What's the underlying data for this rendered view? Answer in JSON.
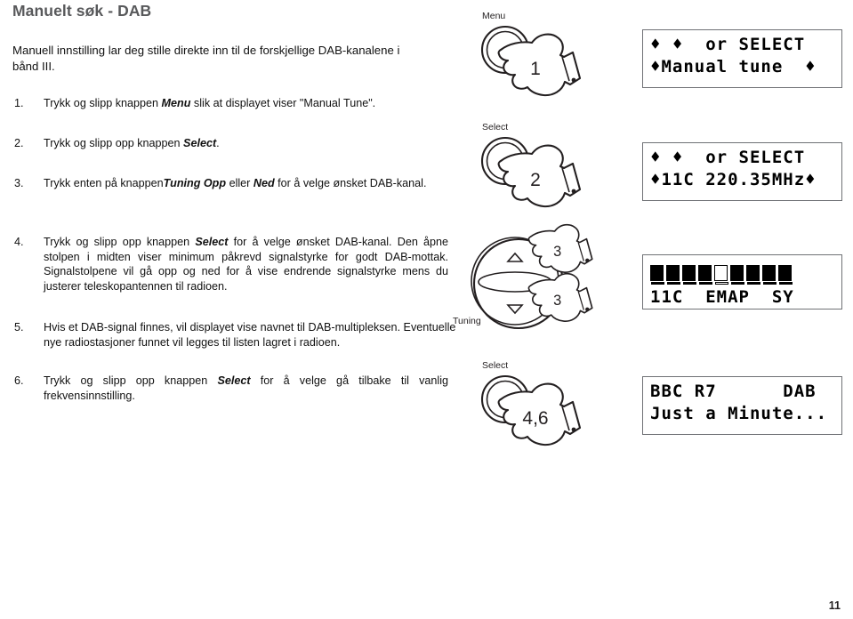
{
  "document": {
    "title": "Manuelt søk - DAB",
    "page_number": "11"
  },
  "intro": "Manuell innstilling lar deg stille direkte inn til de forskjellige DAB-kanalene i bånd III.",
  "steps": [
    {
      "number": "1.",
      "text_1": "Trykk og slipp knappen ",
      "bold_1": "Menu",
      "text_2": " slik at displayet viser \"Manual Tune\".",
      "bold_2": "",
      "text_3": ""
    },
    {
      "number": "2.",
      "text_1": "Trykk og slipp opp knappen ",
      "bold_1": "Select",
      "text_2": ".",
      "bold_2": "",
      "text_3": ""
    },
    {
      "number": "3.",
      "text_1": "Trykk enten på knappen",
      "bold_1": "Tuning Opp",
      "text_2": " eller ",
      "bold_2": "Ned",
      "text_3": " for å velge ønsket DAB-kanal."
    },
    {
      "number": "4.",
      "text_1": "Trykk og slipp opp knappen ",
      "bold_1": "Select",
      "text_2": " for å velge ønsket DAB-kanal. Den åpne stolpen i midten viser minimum påkrevd signalstyrke for godt DAB-mottak. Signalstolpene vil gå opp og ned for å vise endrende signalstyrke mens du justerer teleskopantennen til radioen.",
      "bold_2": "",
      "text_3": ""
    },
    {
      "number": "5.",
      "text_1": "Hvis et DAB-signal finnes, vil displayet vise navnet til DAB-multipleksen. Eventuelle nye radiostasjoner funnet vil legges til listen lagret i radioen.",
      "bold_1": "",
      "text_2": "",
      "bold_2": "",
      "text_3": ""
    },
    {
      "number": "6.",
      "text_1": "Trykk og slipp opp knappen ",
      "bold_1": "Select",
      "text_2": " for å velge gå tilbake til vanlig frekvensinnstilling.",
      "bold_2": "",
      "text_3": ""
    }
  ],
  "illustrations": [
    {
      "button_label": "Menu",
      "step_marker": "1"
    },
    {
      "button_label": "Select",
      "step_marker": "2"
    },
    {
      "knob_label": "Tuning",
      "step_marker_up": "3",
      "step_marker_down": "3",
      "plus": "+",
      "minus": "–"
    },
    {
      "button_label": "Select",
      "step_marker": "4,6"
    }
  ],
  "displays": [
    {
      "line1": "♦ ♦  or SELECT",
      "line2": "♦Manual tune  ♦"
    },
    {
      "line1": "♦ ♦  or SELECT",
      "line2": "♦11C 220.35MHz♦"
    },
    {
      "bars": [
        "filled",
        "filled",
        "filled",
        "filled",
        "hollow",
        "filled",
        "filled",
        "filled",
        "filled"
      ],
      "line2": "11C  EMAP  SY"
    },
    {
      "line1": "BBC R7      DAB",
      "line2": "Just a Minute..."
    }
  ],
  "colors": {
    "title": "#58595b",
    "body_text": "#111111",
    "lcd_border": "#6f7175",
    "ink": "#231f20"
  }
}
